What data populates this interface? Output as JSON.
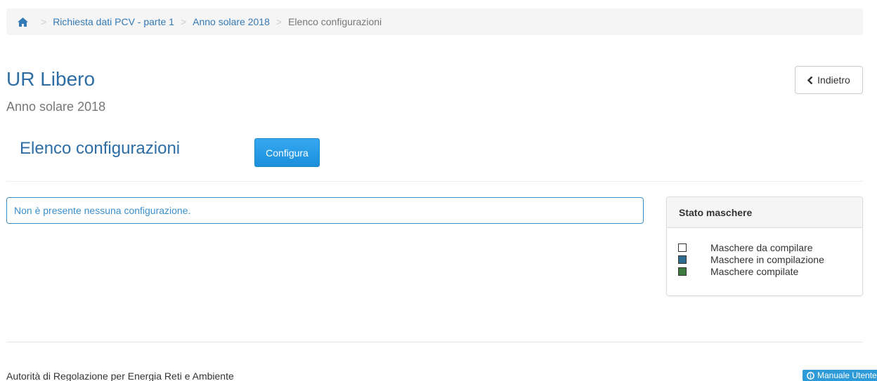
{
  "breadcrumb": {
    "home_icon": "home-icon",
    "items": [
      {
        "label": "Richiesta dati PCV - parte 1",
        "link": true
      },
      {
        "label": "Anno solare 2018",
        "link": true
      },
      {
        "label": "Elenco configurazioni",
        "link": false
      }
    ],
    "separator": ">"
  },
  "header": {
    "title": "UR Libero",
    "subtitle": "Anno solare 2018",
    "back_label": "Indietro"
  },
  "section": {
    "title": "Elenco configurazioni",
    "configure_label": "Configura"
  },
  "alert": {
    "message": "Non è presente nessuna configurazione."
  },
  "legend": {
    "title": "Stato maschere",
    "items": [
      {
        "label": "Maschere da compilare",
        "color": "#ffffff"
      },
      {
        "label": "Maschere in compilazione",
        "color": "#2f6b8c"
      },
      {
        "label": "Maschere compilate",
        "color": "#3d7a3d"
      }
    ]
  },
  "footer": {
    "org": "Autorità di Regolazione per Energia Reti e Ambiente",
    "manual_label": "Manuale Utente"
  },
  "colors": {
    "accent": "#337ab7",
    "button": "#1c8fdc",
    "alert_border": "#3a8fc9"
  }
}
